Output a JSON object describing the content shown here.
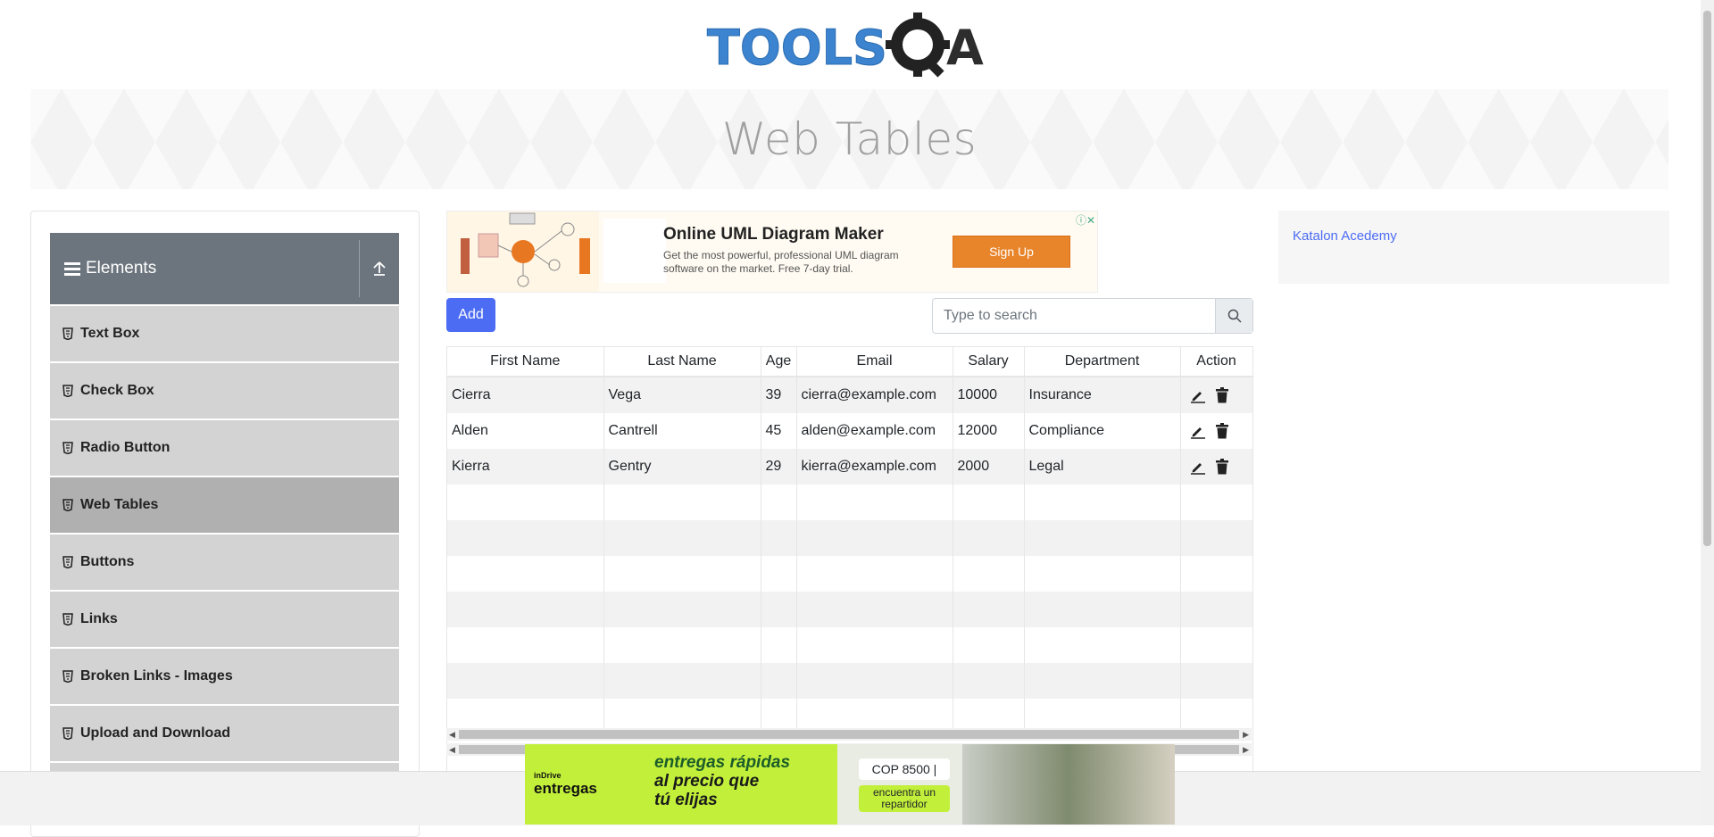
{
  "logo": {
    "text_left": "TOOLS",
    "text_right": "A"
  },
  "banner": {
    "title": "Web Tables"
  },
  "sidebar": {
    "group_title": "Elements",
    "items": [
      {
        "label": "Text Box"
      },
      {
        "label": "Check Box"
      },
      {
        "label": "Radio Button"
      },
      {
        "label": "Web Tables"
      },
      {
        "label": "Buttons"
      },
      {
        "label": "Links"
      },
      {
        "label": "Broken Links - Images"
      },
      {
        "label": "Upload and Download"
      }
    ]
  },
  "ad_top": {
    "title": "Online UML Diagram Maker",
    "desc": "Get the most powerful, professional UML diagram software on the market. Free 7-day trial.",
    "button": "Sign Up"
  },
  "toolbar": {
    "add_label": "Add",
    "search_placeholder": "Type to search"
  },
  "table": {
    "headers": [
      "First Name",
      "Last Name",
      "Age",
      "Email",
      "Salary",
      "Department",
      "Action"
    ],
    "rows": [
      {
        "first": "Cierra",
        "last": "Vega",
        "age": "39",
        "email": "cierra@example.com",
        "salary": "10000",
        "dept": "Insurance"
      },
      {
        "first": "Alden",
        "last": "Cantrell",
        "age": "45",
        "email": "alden@example.com",
        "salary": "12000",
        "dept": "Compliance"
      },
      {
        "first": "Kierra",
        "last": "Gentry",
        "age": "29",
        "email": "kierra@example.com",
        "salary": "2000",
        "dept": "Legal"
      }
    ]
  },
  "right_ad": {
    "alt": "Katalon Acedemy"
  },
  "bottom_ad": {
    "brand": "entregas",
    "brand_small": "inDrive",
    "slogan1": "entregas rápidas",
    "slogan2": "al precio que",
    "slogan3": "tú elijas",
    "price": "COP 8500 |",
    "cta": "encuentra un repartidor"
  },
  "colors": {
    "accent": "#4d6cf4",
    "sidebar_header": "#6c757d",
    "menu_item": "#d3d3d3",
    "menu_active": "#b0b0b0"
  }
}
